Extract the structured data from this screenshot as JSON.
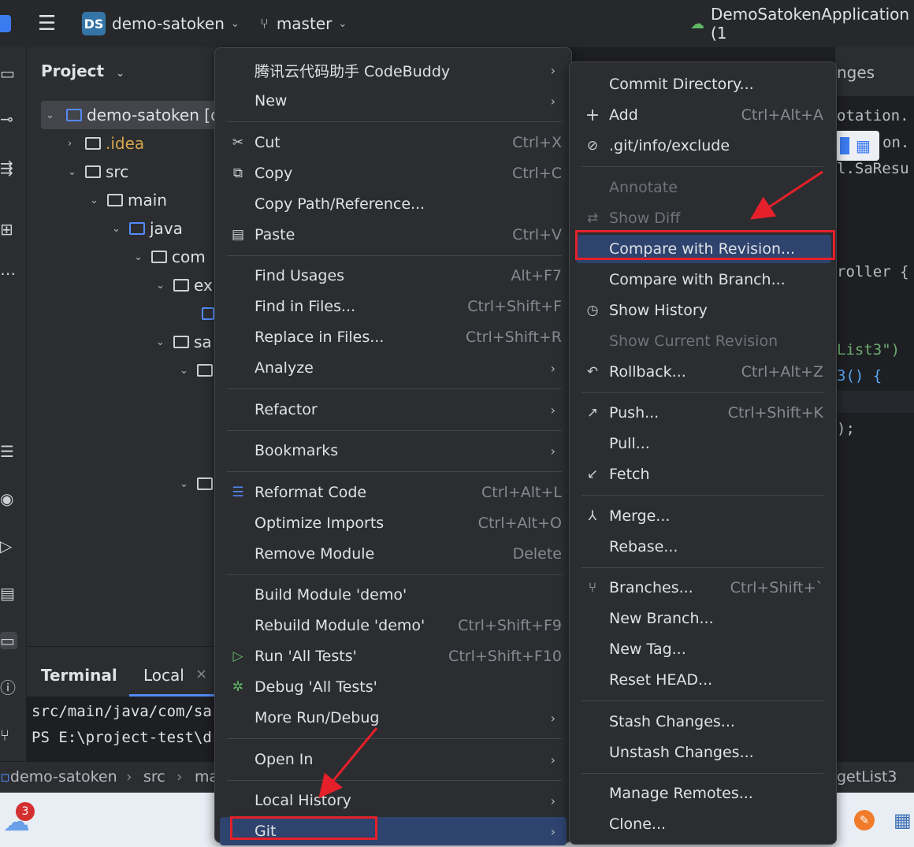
{
  "titlebar": {
    "project_badge": "DS",
    "project_name": "demo-satoken",
    "branch": "master",
    "run_config": "DemoSatokenApplication (1"
  },
  "project_panel": {
    "title": "Project",
    "tree": [
      {
        "label": "demo-satoken [d",
        "arrow": "⌄"
      },
      {
        "label": ".idea",
        "arrow": "›"
      },
      {
        "label": "src",
        "arrow": "⌄"
      },
      {
        "label": "main",
        "arrow": "⌄"
      },
      {
        "label": "java",
        "arrow": "⌄"
      },
      {
        "label": "com",
        "arrow": "⌄"
      },
      {
        "label": "ex",
        "arrow": "⌄"
      },
      {
        "label": "sa",
        "arrow": "⌄"
      }
    ]
  },
  "editor": {
    "tab_fragment": "nges",
    "lines": [
      "otation.",
      "on.",
      "l.SaResu",
      "roller {",
      "List3\")",
      "3() {",
      ");"
    ]
  },
  "terminal": {
    "title": "Terminal",
    "tab": "Local",
    "lines": [
      "src/main/java/com/sa",
      "PS E:\\project-test\\d"
    ]
  },
  "breadcrumb": {
    "items": [
      "demo-satoken",
      "src",
      "ma"
    ],
    "tail": "getList3"
  },
  "taskbar": {
    "badge_count": "3"
  },
  "context_menu": {
    "items": [
      {
        "label": "腾讯云代码助手 CodeBuddy",
        "submenu": true
      },
      {
        "label": "New",
        "submenu": true
      },
      {
        "label": "Cut",
        "shortcut": "Ctrl+X"
      },
      {
        "label": "Copy",
        "shortcut": "Ctrl+C"
      },
      {
        "label": "Copy Path/Reference..."
      },
      {
        "label": "Paste",
        "shortcut": "Ctrl+V"
      },
      {
        "label": "Find Usages",
        "shortcut": "Alt+F7"
      },
      {
        "label": "Find in Files...",
        "shortcut": "Ctrl+Shift+F"
      },
      {
        "label": "Replace in Files...",
        "shortcut": "Ctrl+Shift+R"
      },
      {
        "label": "Analyze",
        "submenu": true
      },
      {
        "label": "Refactor",
        "submenu": true
      },
      {
        "label": "Bookmarks",
        "submenu": true
      },
      {
        "label": "Reformat Code",
        "shortcut": "Ctrl+Alt+L"
      },
      {
        "label": "Optimize Imports",
        "shortcut": "Ctrl+Alt+O"
      },
      {
        "label": "Remove Module",
        "shortcut": "Delete"
      },
      {
        "label": "Build Module 'demo'"
      },
      {
        "label": "Rebuild Module 'demo'",
        "shortcut": "Ctrl+Shift+F9"
      },
      {
        "label": "Run 'All Tests'",
        "shortcut": "Ctrl+Shift+F10"
      },
      {
        "label": "Debug 'All Tests'"
      },
      {
        "label": "More Run/Debug",
        "submenu": true
      },
      {
        "label": "Open In",
        "submenu": true
      },
      {
        "label": "Local History",
        "submenu": true
      },
      {
        "label": "Git",
        "submenu": true
      }
    ]
  },
  "git_menu": {
    "items": [
      {
        "label": "Commit Directory..."
      },
      {
        "label": "Add",
        "shortcut": "Ctrl+Alt+A"
      },
      {
        "label": ".git/info/exclude"
      },
      {
        "label": "Annotate",
        "disabled": true
      },
      {
        "label": "Show Diff",
        "disabled": true
      },
      {
        "label": "Compare with Revision..."
      },
      {
        "label": "Compare with Branch..."
      },
      {
        "label": "Show History"
      },
      {
        "label": "Show Current Revision",
        "disabled": true
      },
      {
        "label": "Rollback...",
        "shortcut": "Ctrl+Alt+Z"
      },
      {
        "label": "Push...",
        "shortcut": "Ctrl+Shift+K"
      },
      {
        "label": "Pull..."
      },
      {
        "label": "Fetch"
      },
      {
        "label": "Merge..."
      },
      {
        "label": "Rebase..."
      },
      {
        "label": "Branches...",
        "shortcut": "Ctrl+Shift+`"
      },
      {
        "label": "New Branch..."
      },
      {
        "label": "New Tag..."
      },
      {
        "label": "Reset HEAD..."
      },
      {
        "label": "Stash Changes..."
      },
      {
        "label": "Unstash Changes..."
      },
      {
        "label": "Manage Remotes..."
      },
      {
        "label": "Clone..."
      }
    ]
  },
  "colors": {
    "highlight": "#2e436e",
    "annotation_red": "#e5202a",
    "menu_bg": "#2b2d30"
  }
}
